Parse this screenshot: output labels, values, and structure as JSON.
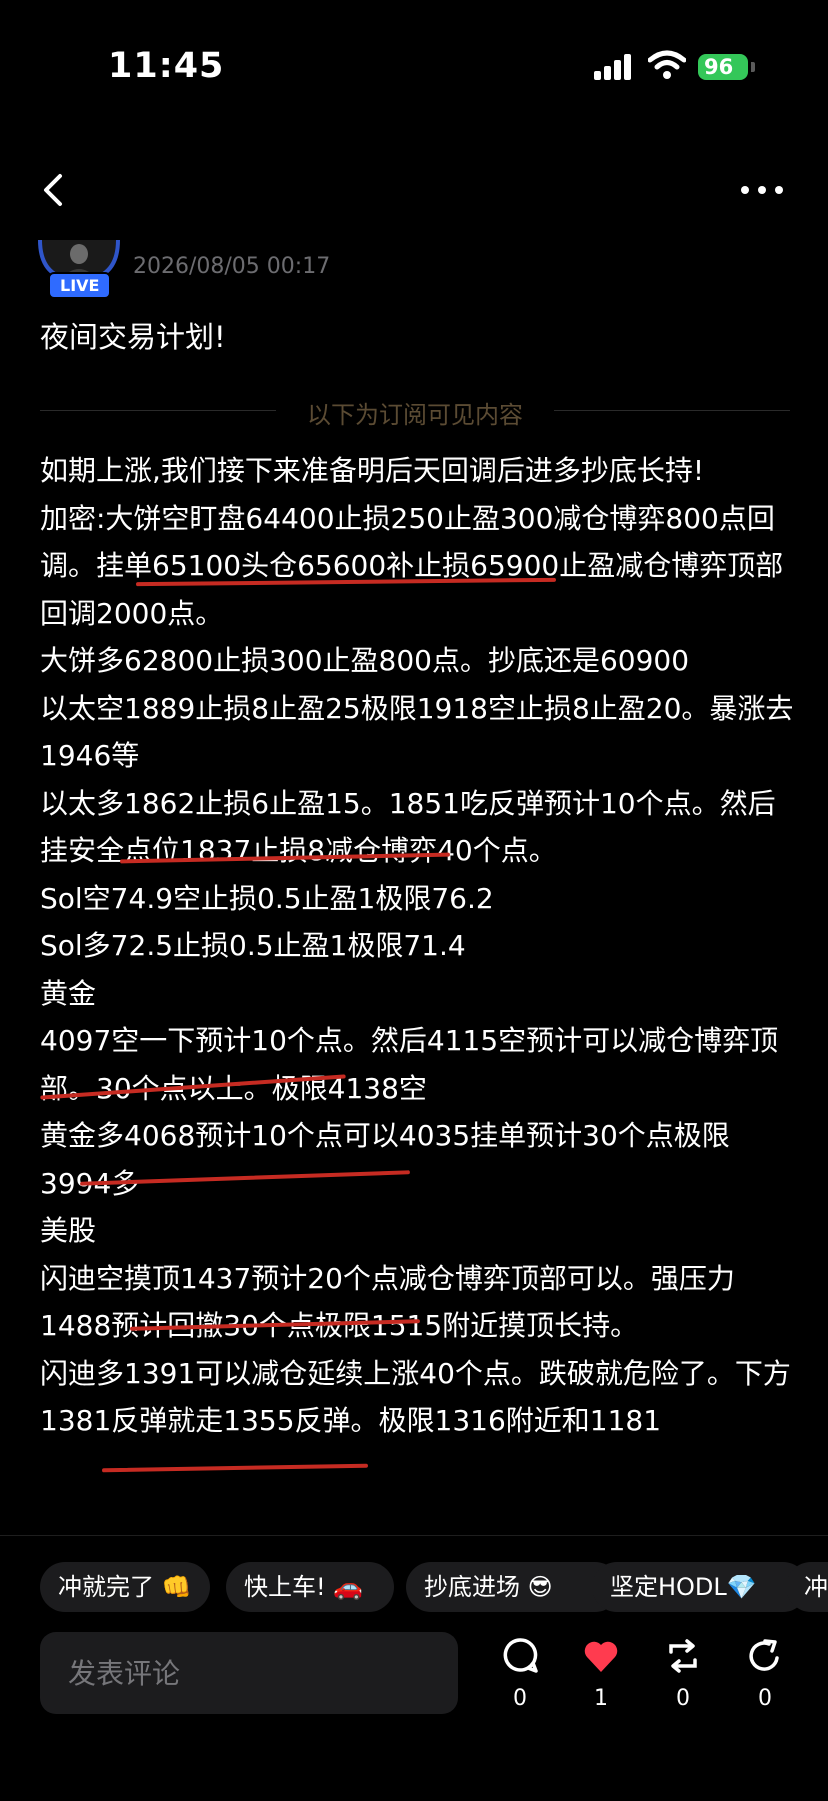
{
  "status_bar": {
    "time": "11:45",
    "battery": "96"
  },
  "post": {
    "timestamp": "2026/08/05 00:17",
    "live_badge": "LIVE",
    "title": "夜间交易计划!",
    "divider_label": "以下为订阅可见内容",
    "paragraphs": [
      "如期上涨,我们接下来准备明后天回调后进多抄底长持!",
      "加密:大饼空盯盘64400止损250止盈300减仓博弈800点回调。挂单65100头仓65600补止损65900止盈减仓博弈顶部回调2000点。",
      "大饼多62800止损300止盈800点。抄底还是60900",
      "以太空1889止损8止盈25极限1918空止损8止盈20。暴涨去1946等",
      "以太多1862止损6止盈15。1851吃反弹预计10个点。然后挂安全点位1837止损8减仓博弈40个点。",
      "Sol空74.9空止损0.5止盈1极限76.2",
      "Sol多72.5止损0.5止盈1极限71.4",
      "黄金",
      "4097空一下预计10个点。然后4115空预计可以减仓博弈顶部。30个点以上。极限4138空",
      "黄金多4068预计10个点可以4035挂单预计30个点极限3994多",
      "美股",
      "闪迪空摸顶1437预计20个点减仓博弈顶部可以。强压力1488预计回撤30个点极限1515附近摸顶长持。",
      "闪迪多1391可以减仓延续上涨40个点。跌破就危险了。下方1381反弹就走1355反弹。极限1316附近和1181"
    ]
  },
  "quick_replies": [
    "冲就完了 👊",
    "快上车! 🚗",
    "抄底进场 😎",
    "坚定HODL💎",
    "冲"
  ],
  "comment": {
    "placeholder": "发表评论"
  },
  "actions": {
    "comment_count": "0",
    "like_count": "1",
    "repost_count": "0",
    "share_count": "0"
  },
  "colors": {
    "background": "#000000",
    "accent": "#2f6bff",
    "like": "#ff3b4f",
    "underline": "#c62b22",
    "battery": "#34c759"
  }
}
